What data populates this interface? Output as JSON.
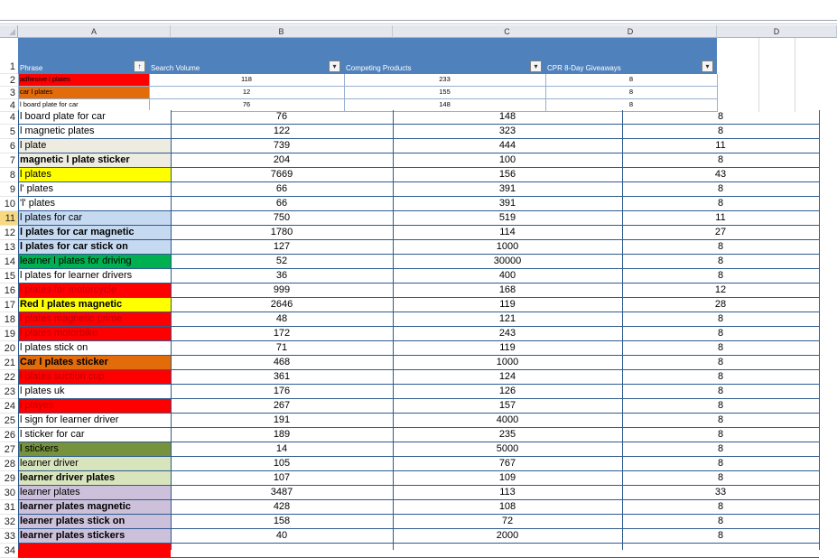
{
  "columns": [
    "A",
    "B",
    "C",
    "D",
    "D"
  ],
  "header": {
    "row_label": "1",
    "phrase": "Phrase",
    "search_volume": "Search Volume",
    "competing_products": "Competing Products",
    "giveaways": "CPR 8-Day Giveaways",
    "sort_filter_glyph": "↑",
    "filter_glyph": "▾"
  },
  "small_rows": [
    {
      "row": "2",
      "phrase": "adhesive l plates",
      "vol": "118",
      "comp": "233",
      "give": "8",
      "bg": "#ff0000",
      "fg": "#000000"
    },
    {
      "row": "3",
      "phrase": "car l plates",
      "vol": "12",
      "comp": "155",
      "give": "8",
      "bg": "#e26b0a",
      "fg": "#000000"
    },
    {
      "row": "4",
      "phrase": "l board plate for car",
      "vol": "76",
      "comp": "148",
      "give": "8",
      "bg": "#ffffff",
      "fg": "#000000"
    }
  ],
  "rows": [
    {
      "row": "4",
      "phrase": "l board plate for car",
      "vol": "76",
      "comp": "148",
      "give": "8",
      "bg": "#ffffff",
      "fg": "#000000",
      "bold": false
    },
    {
      "row": "5",
      "phrase": "l magnetic plates",
      "vol": "122",
      "comp": "323",
      "give": "8",
      "bg": "#ffffff",
      "fg": "#000000",
      "bold": false
    },
    {
      "row": "6",
      "phrase": "l plate",
      "vol": "739",
      "comp": "444",
      "give": "11",
      "bg": "#eeece1",
      "fg": "#000000",
      "bold": false
    },
    {
      "row": "7",
      "phrase": "magnetic l plate sticker",
      "vol": "204",
      "comp": "100",
      "give": "8",
      "bg": "#eeece1",
      "fg": "#000000",
      "bold": true
    },
    {
      "row": "8",
      "phrase": "l plates",
      "vol": "7669",
      "comp": "156",
      "give": "43",
      "bg": "#ffff00",
      "fg": "#000000",
      "bold": false
    },
    {
      "row": "9",
      "phrase": "l' plates",
      "vol": "66",
      "comp": "391",
      "give": "8",
      "bg": "#ffffff",
      "fg": "#000000",
      "bold": false
    },
    {
      "row": "10",
      "phrase": "'l' plates",
      "vol": "66",
      "comp": "391",
      "give": "8",
      "bg": "#ffffff",
      "fg": "#000000",
      "bold": false
    },
    {
      "row": "11",
      "phrase": "l plates for car",
      "vol": "750",
      "comp": "519",
      "give": "11",
      "bg": "#c5d9f1",
      "fg": "#000000",
      "bold": false,
      "selected": true
    },
    {
      "row": "12",
      "phrase": "l plates for car magnetic",
      "vol": "1780",
      "comp": "114",
      "give": "27",
      "bg": "#c5d9f1",
      "fg": "#000000",
      "bold": true
    },
    {
      "row": "13",
      "phrase": "l plates for car stick on",
      "vol": "127",
      "comp": "1000",
      "give": "8",
      "bg": "#c5d9f1",
      "fg": "#000000",
      "bold": true
    },
    {
      "row": "14",
      "phrase": "learner l plates for driving",
      "vol": "52",
      "comp": "30000",
      "give": "8",
      "bg": "#00b050",
      "fg": "#000000",
      "bold": false
    },
    {
      "row": "15",
      "phrase": "l plates for learner drivers",
      "vol": "36",
      "comp": "400",
      "give": "8",
      "bg": "#ffffff",
      "fg": "#000000",
      "bold": false
    },
    {
      "row": "16",
      "phrase": "l plates for motorcycle",
      "vol": "999",
      "comp": "168",
      "give": "12",
      "bg": "#ff0000",
      "fg": "#c00000",
      "bold": false
    },
    {
      "row": "17",
      "phrase": "Red l plates magnetic",
      "vol": "2646",
      "comp": "119",
      "give": "28",
      "bg": "#ffff00",
      "fg": "#000000",
      "bold": true
    },
    {
      "row": "18",
      "phrase": "l plates magnetic prime",
      "vol": "48",
      "comp": "121",
      "give": "8",
      "bg": "#ff0000",
      "fg": "#c00000",
      "bold": false
    },
    {
      "row": "19",
      "phrase": "l plates motorbike",
      "vol": "172",
      "comp": "243",
      "give": "8",
      "bg": "#ff0000",
      "fg": "#c00000",
      "bold": false
    },
    {
      "row": "20",
      "phrase": "l plates stick on",
      "vol": "71",
      "comp": "119",
      "give": "8",
      "bg": "#ffffff",
      "fg": "#000000",
      "bold": false
    },
    {
      "row": "21",
      "phrase": "Car l plates sticker",
      "vol": "468",
      "comp": "1000",
      "give": "8",
      "bg": "#e26b0a",
      "fg": "#000000",
      "bold": true
    },
    {
      "row": "22",
      "phrase": "l plates suction cup",
      "vol": "361",
      "comp": "124",
      "give": "8",
      "bg": "#ff0000",
      "fg": "#c00000",
      "bold": false
    },
    {
      "row": "23",
      "phrase": "l plates uk",
      "vol": "176",
      "comp": "126",
      "give": "8",
      "bg": "#ffffff",
      "fg": "#000000",
      "bold": false
    },
    {
      "row": "24",
      "phrase": "l playes",
      "vol": "267",
      "comp": "157",
      "give": "8",
      "bg": "#ff0000",
      "fg": "#c00000",
      "bold": false
    },
    {
      "row": "25",
      "phrase": "l sign for learner driver",
      "vol": "191",
      "comp": "4000",
      "give": "8",
      "bg": "#ffffff",
      "fg": "#000000",
      "bold": false
    },
    {
      "row": "26",
      "phrase": "l sticker for car",
      "vol": "189",
      "comp": "235",
      "give": "8",
      "bg": "#ffffff",
      "fg": "#000000",
      "bold": false
    },
    {
      "row": "27",
      "phrase": "l stickers",
      "vol": "14",
      "comp": "5000",
      "give": "8",
      "bg": "#76923c",
      "fg": "#000000",
      "bold": false
    },
    {
      "row": "28",
      "phrase": "learner driver",
      "vol": "105",
      "comp": "767",
      "give": "8",
      "bg": "#d8e4bc",
      "fg": "#000000",
      "bold": false
    },
    {
      "row": "29",
      "phrase": "learner driver plates",
      "vol": "107",
      "comp": "109",
      "give": "8",
      "bg": "#d8e4bc",
      "fg": "#000000",
      "bold": true
    },
    {
      "row": "30",
      "phrase": "learner plates",
      "vol": "3487",
      "comp": "113",
      "give": "33",
      "bg": "#ccc0da",
      "fg": "#000000",
      "bold": false
    },
    {
      "row": "31",
      "phrase": "learner plates magnetic",
      "vol": "428",
      "comp": "108",
      "give": "8",
      "bg": "#ccc0da",
      "fg": "#000000",
      "bold": true
    },
    {
      "row": "32",
      "phrase": "learner plates stick on",
      "vol": "158",
      "comp": "72",
      "give": "8",
      "bg": "#ccc0da",
      "fg": "#000000",
      "bold": true
    },
    {
      "row": "33",
      "phrase": "learner plates stickers",
      "vol": "40",
      "comp": "2000",
      "give": "8",
      "bg": "#ccc0da",
      "fg": "#000000",
      "bold": true
    },
    {
      "row": "34",
      "phrase": "",
      "vol": "",
      "comp": "",
      "give": "",
      "bg": "#ff0000",
      "fg": "#000000",
      "bold": false
    }
  ]
}
